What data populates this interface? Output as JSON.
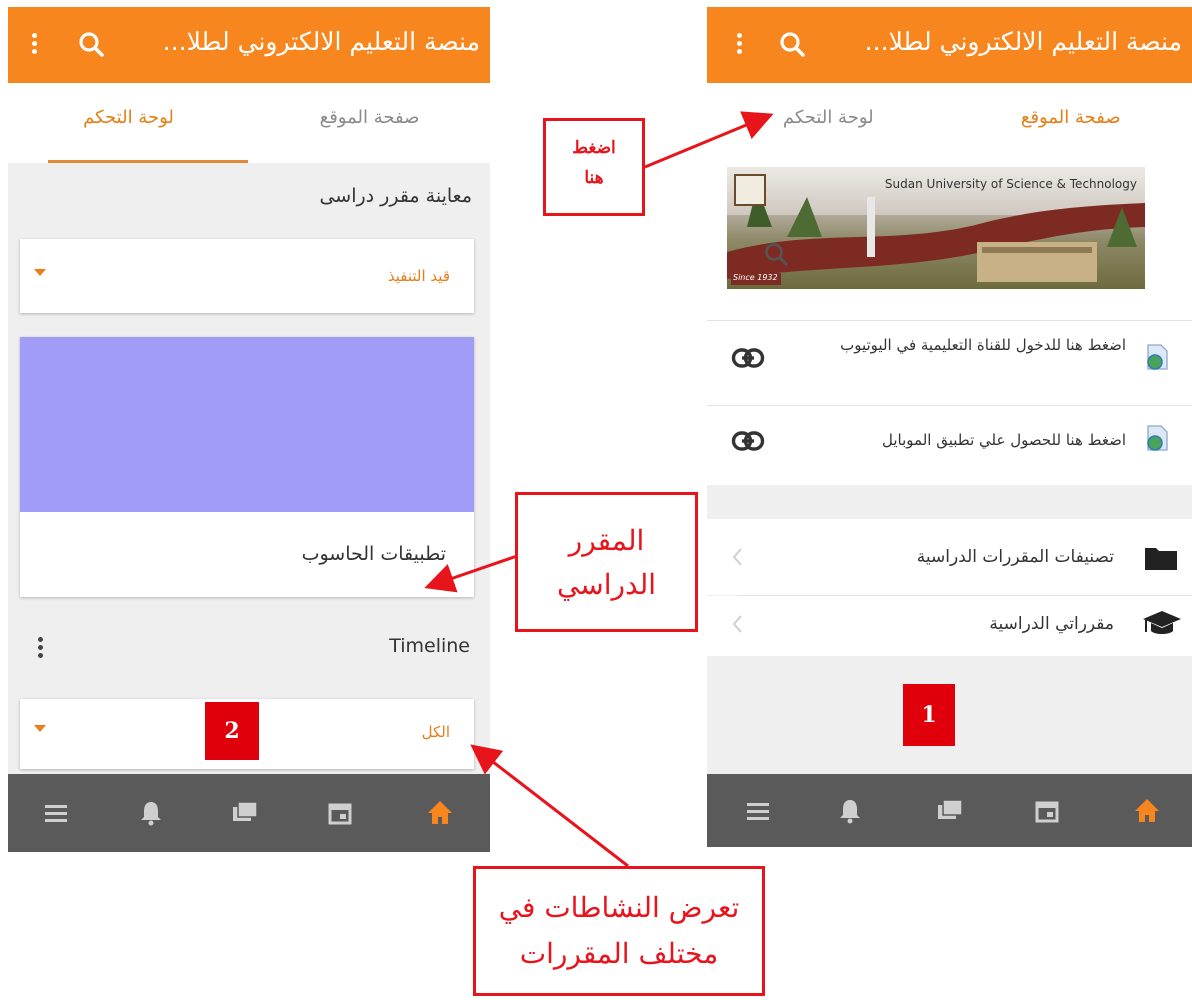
{
  "app": {
    "title": "منصة التعليم الالكتروني لطلا...",
    "accent_color": "#f7861e",
    "nav_bar_color": "#5a5a5a"
  },
  "left_screen": {
    "tabs": [
      {
        "label": "صفحة الموقع",
        "active": false
      },
      {
        "label": "لوحة التحكم",
        "active": true
      }
    ],
    "course_overview_title": "معاينة مقرر دراسى",
    "filter_select_value": "قيد التنفيذ",
    "course_card": {
      "name": "تطبيقات الحاسوب",
      "image_color": "#a09cf7"
    },
    "timeline_title": "Timeline",
    "timeline_filter_value": "الكل",
    "badge": "2"
  },
  "right_screen": {
    "tabs": [
      {
        "label": "صفحة الموقع",
        "active": true
      },
      {
        "label": "لوحة التحكم",
        "active": false
      }
    ],
    "banner_text": "Sudan University of Science & Technology",
    "banner_since": "Since 1932",
    "links": [
      {
        "text": "اضغط هنا للدخول للقناة التعليمية في اليوتيوب",
        "icon": "url-document-icon",
        "action_icon": "link-icon"
      },
      {
        "text": "اضغط هنا للحصول علي تطبيق الموبايل",
        "icon": "url-document-icon",
        "action_icon": "link-icon"
      }
    ],
    "menu": [
      {
        "label": "تصنيفات المقررات الدراسية",
        "icon": "folder-icon"
      },
      {
        "label": "مقرراتي الدراسية",
        "icon": "graduation-cap-icon"
      }
    ],
    "badge": "1"
  },
  "bottom_nav": [
    "menu-icon",
    "bell-icon",
    "messages-icon",
    "calendar-icon",
    "home-icon"
  ],
  "annotations": {
    "press_here_line1": "اضغط",
    "press_here_line2": "هنا",
    "course_line1": "المقرر",
    "course_line2": "الدراسي",
    "activities_line1": "تعرض النشاطات في",
    "activities_line2": "مختلف المقررات"
  }
}
